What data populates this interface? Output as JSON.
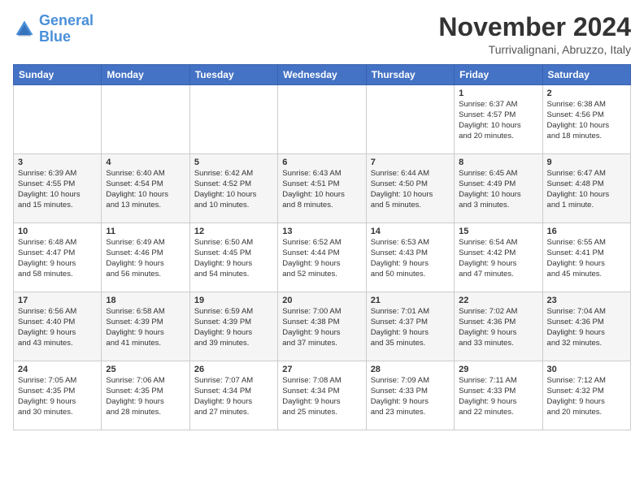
{
  "logo": {
    "text_general": "General",
    "text_blue": "Blue"
  },
  "title": "November 2024",
  "location": "Turrivalignani, Abruzzo, Italy",
  "days_of_week": [
    "Sunday",
    "Monday",
    "Tuesday",
    "Wednesday",
    "Thursday",
    "Friday",
    "Saturday"
  ],
  "weeks": [
    [
      {
        "day": "",
        "info": ""
      },
      {
        "day": "",
        "info": ""
      },
      {
        "day": "",
        "info": ""
      },
      {
        "day": "",
        "info": ""
      },
      {
        "day": "",
        "info": ""
      },
      {
        "day": "1",
        "info": "Sunrise: 6:37 AM\nSunset: 4:57 PM\nDaylight: 10 hours\nand 20 minutes."
      },
      {
        "day": "2",
        "info": "Sunrise: 6:38 AM\nSunset: 4:56 PM\nDaylight: 10 hours\nand 18 minutes."
      }
    ],
    [
      {
        "day": "3",
        "info": "Sunrise: 6:39 AM\nSunset: 4:55 PM\nDaylight: 10 hours\nand 15 minutes."
      },
      {
        "day": "4",
        "info": "Sunrise: 6:40 AM\nSunset: 4:54 PM\nDaylight: 10 hours\nand 13 minutes."
      },
      {
        "day": "5",
        "info": "Sunrise: 6:42 AM\nSunset: 4:52 PM\nDaylight: 10 hours\nand 10 minutes."
      },
      {
        "day": "6",
        "info": "Sunrise: 6:43 AM\nSunset: 4:51 PM\nDaylight: 10 hours\nand 8 minutes."
      },
      {
        "day": "7",
        "info": "Sunrise: 6:44 AM\nSunset: 4:50 PM\nDaylight: 10 hours\nand 5 minutes."
      },
      {
        "day": "8",
        "info": "Sunrise: 6:45 AM\nSunset: 4:49 PM\nDaylight: 10 hours\nand 3 minutes."
      },
      {
        "day": "9",
        "info": "Sunrise: 6:47 AM\nSunset: 4:48 PM\nDaylight: 10 hours\nand 1 minute."
      }
    ],
    [
      {
        "day": "10",
        "info": "Sunrise: 6:48 AM\nSunset: 4:47 PM\nDaylight: 9 hours\nand 58 minutes."
      },
      {
        "day": "11",
        "info": "Sunrise: 6:49 AM\nSunset: 4:46 PM\nDaylight: 9 hours\nand 56 minutes."
      },
      {
        "day": "12",
        "info": "Sunrise: 6:50 AM\nSunset: 4:45 PM\nDaylight: 9 hours\nand 54 minutes."
      },
      {
        "day": "13",
        "info": "Sunrise: 6:52 AM\nSunset: 4:44 PM\nDaylight: 9 hours\nand 52 minutes."
      },
      {
        "day": "14",
        "info": "Sunrise: 6:53 AM\nSunset: 4:43 PM\nDaylight: 9 hours\nand 50 minutes."
      },
      {
        "day": "15",
        "info": "Sunrise: 6:54 AM\nSunset: 4:42 PM\nDaylight: 9 hours\nand 47 minutes."
      },
      {
        "day": "16",
        "info": "Sunrise: 6:55 AM\nSunset: 4:41 PM\nDaylight: 9 hours\nand 45 minutes."
      }
    ],
    [
      {
        "day": "17",
        "info": "Sunrise: 6:56 AM\nSunset: 4:40 PM\nDaylight: 9 hours\nand 43 minutes."
      },
      {
        "day": "18",
        "info": "Sunrise: 6:58 AM\nSunset: 4:39 PM\nDaylight: 9 hours\nand 41 minutes."
      },
      {
        "day": "19",
        "info": "Sunrise: 6:59 AM\nSunset: 4:39 PM\nDaylight: 9 hours\nand 39 minutes."
      },
      {
        "day": "20",
        "info": "Sunrise: 7:00 AM\nSunset: 4:38 PM\nDaylight: 9 hours\nand 37 minutes."
      },
      {
        "day": "21",
        "info": "Sunrise: 7:01 AM\nSunset: 4:37 PM\nDaylight: 9 hours\nand 35 minutes."
      },
      {
        "day": "22",
        "info": "Sunrise: 7:02 AM\nSunset: 4:36 PM\nDaylight: 9 hours\nand 33 minutes."
      },
      {
        "day": "23",
        "info": "Sunrise: 7:04 AM\nSunset: 4:36 PM\nDaylight: 9 hours\nand 32 minutes."
      }
    ],
    [
      {
        "day": "24",
        "info": "Sunrise: 7:05 AM\nSunset: 4:35 PM\nDaylight: 9 hours\nand 30 minutes."
      },
      {
        "day": "25",
        "info": "Sunrise: 7:06 AM\nSunset: 4:35 PM\nDaylight: 9 hours\nand 28 minutes."
      },
      {
        "day": "26",
        "info": "Sunrise: 7:07 AM\nSunset: 4:34 PM\nDaylight: 9 hours\nand 27 minutes."
      },
      {
        "day": "27",
        "info": "Sunrise: 7:08 AM\nSunset: 4:34 PM\nDaylight: 9 hours\nand 25 minutes."
      },
      {
        "day": "28",
        "info": "Sunrise: 7:09 AM\nSunset: 4:33 PM\nDaylight: 9 hours\nand 23 minutes."
      },
      {
        "day": "29",
        "info": "Sunrise: 7:11 AM\nSunset: 4:33 PM\nDaylight: 9 hours\nand 22 minutes."
      },
      {
        "day": "30",
        "info": "Sunrise: 7:12 AM\nSunset: 4:32 PM\nDaylight: 9 hours\nand 20 minutes."
      }
    ]
  ]
}
